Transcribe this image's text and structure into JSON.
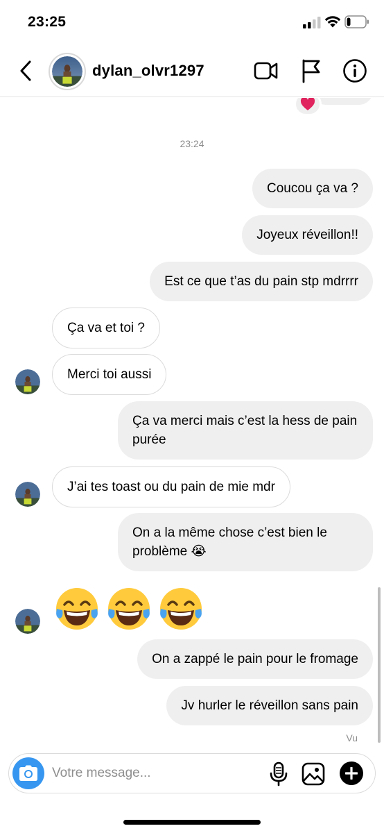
{
  "status_bar": {
    "time": "23:25",
    "battery_level": 0.2
  },
  "header": {
    "username": "dylan_olvr1297",
    "icons": [
      "back-chevron-icon",
      "video-call-icon",
      "flag-icon",
      "info-icon"
    ]
  },
  "thread": {
    "reaction": "heart",
    "timestamp": "23:24",
    "messages": [
      {
        "from": "me",
        "text": "Coucou ça va ?"
      },
      {
        "from": "me",
        "text": "Joyeux réveillon!!"
      },
      {
        "from": "me",
        "text": "Est ce que t’as du pain stp mdrrrr"
      },
      {
        "from": "them",
        "text": "Ça va et toi ?"
      },
      {
        "from": "them",
        "text": "Merci toi aussi"
      },
      {
        "from": "me",
        "text": "Ça va merci mais c’est la hess de pain purée"
      },
      {
        "from": "them",
        "text": "J’ai tes toast ou du pain de mie mdr"
      },
      {
        "from": "me",
        "text": "On a la même chose c’est bien le problème 😭"
      },
      {
        "from": "them",
        "text": "😂😂😂"
      },
      {
        "from": "me",
        "text": "On a zappé le pain pour le fromage"
      },
      {
        "from": "me",
        "text": "Jv hurler le réveillon sans pain"
      }
    ],
    "seen_label": "Vu"
  },
  "composer": {
    "placeholder": "Votre message...",
    "value": "",
    "accent_color": "#3797f0"
  }
}
